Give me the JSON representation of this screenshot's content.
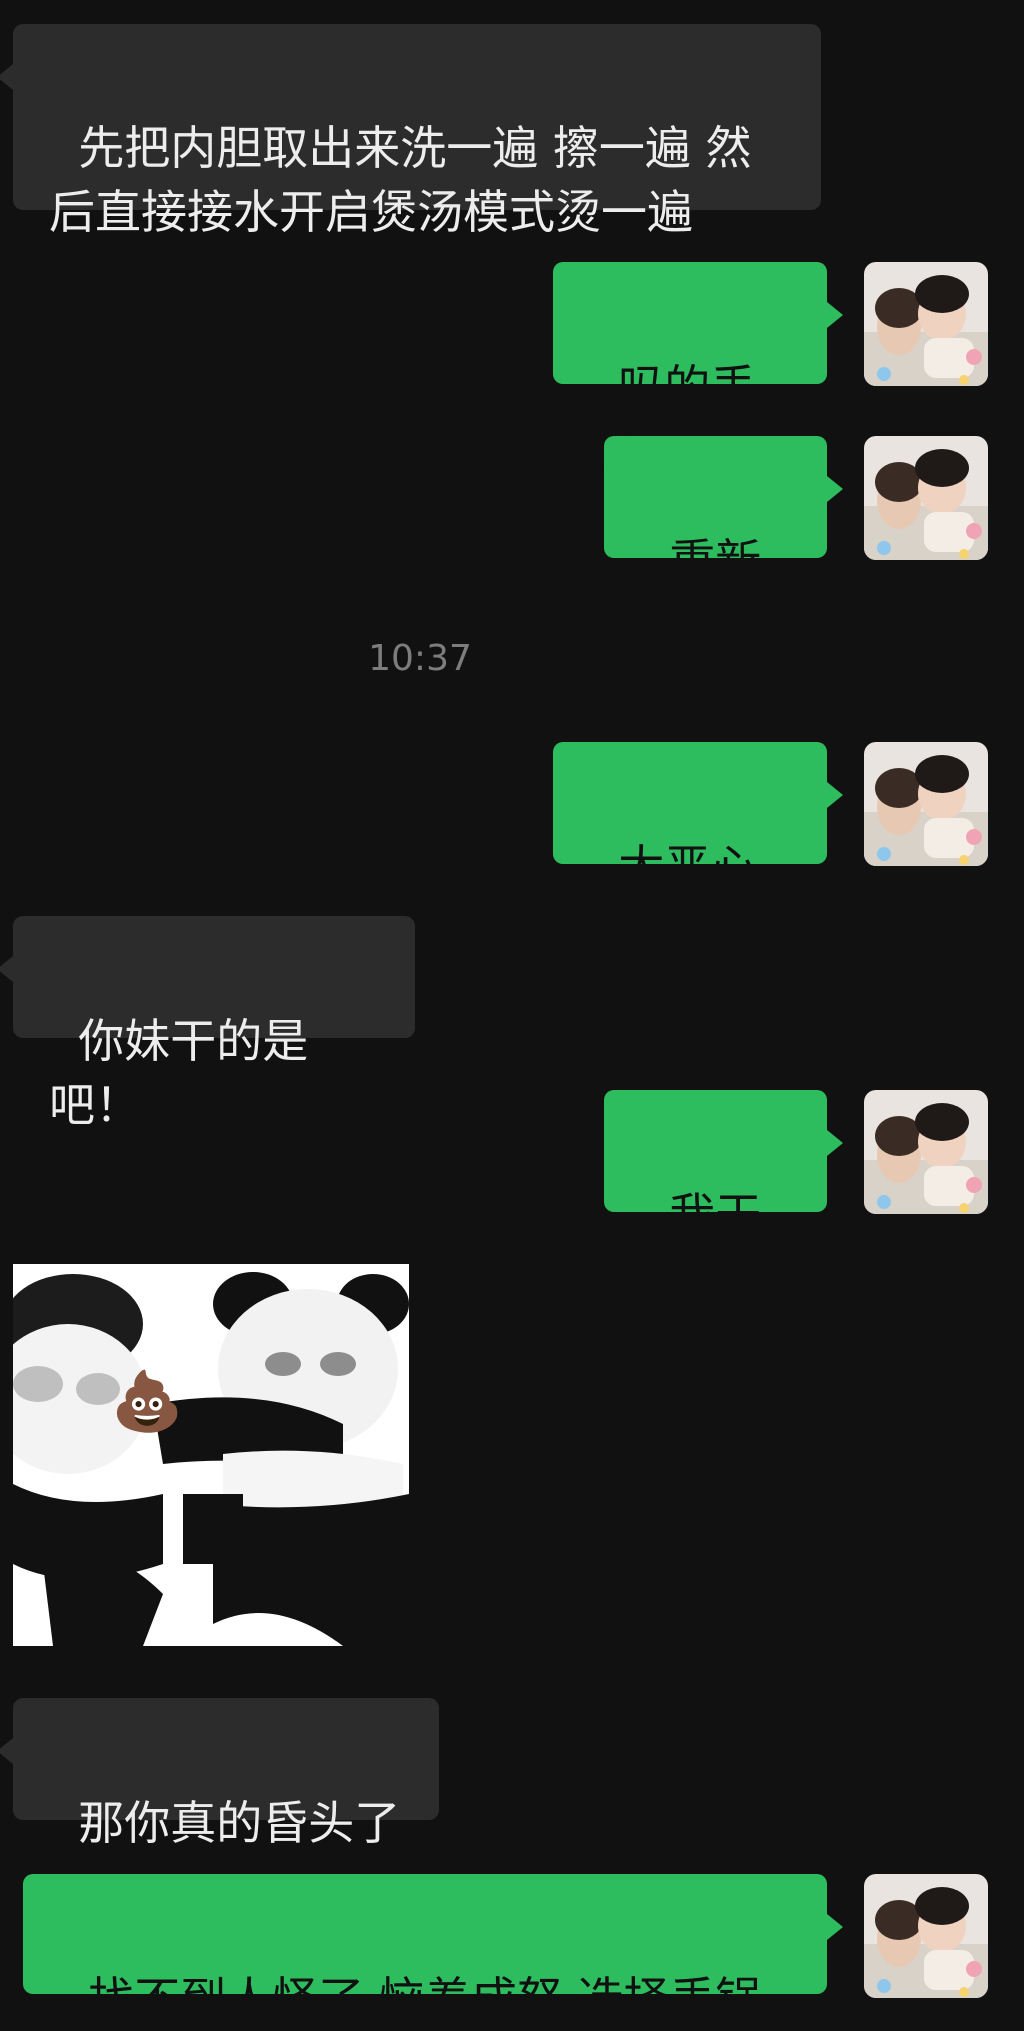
{
  "messages": {
    "m1": {
      "text": "先把内胆取出来洗一遍 擦一遍 然\n后直接接水开启煲汤模式烫一遍"
    },
    "m2": {
      "text": "吗的丢了"
    },
    "m3": {
      "text": "重新买"
    },
    "m4": {
      "text": "太恶心了"
    },
    "m5": {
      "text": "你妹干的是吧！"
    },
    "m6": {
      "text": "我干的"
    },
    "m7": {
      "emoji": "💩"
    },
    "m8": {
      "text": "那你真的昏头了"
    },
    "m9": {
      "text": "找不到人怪了 恼羞成怒 选择丢锅"
    }
  },
  "timestamp": "10:37",
  "colors": {
    "background": "#111111",
    "incoming_bubble": "#2c2c2c",
    "outgoing_bubble": "#2ebd5e"
  },
  "icons": {
    "avatar": "user-avatar-photo",
    "sticker": "panda-meme-sticker"
  }
}
